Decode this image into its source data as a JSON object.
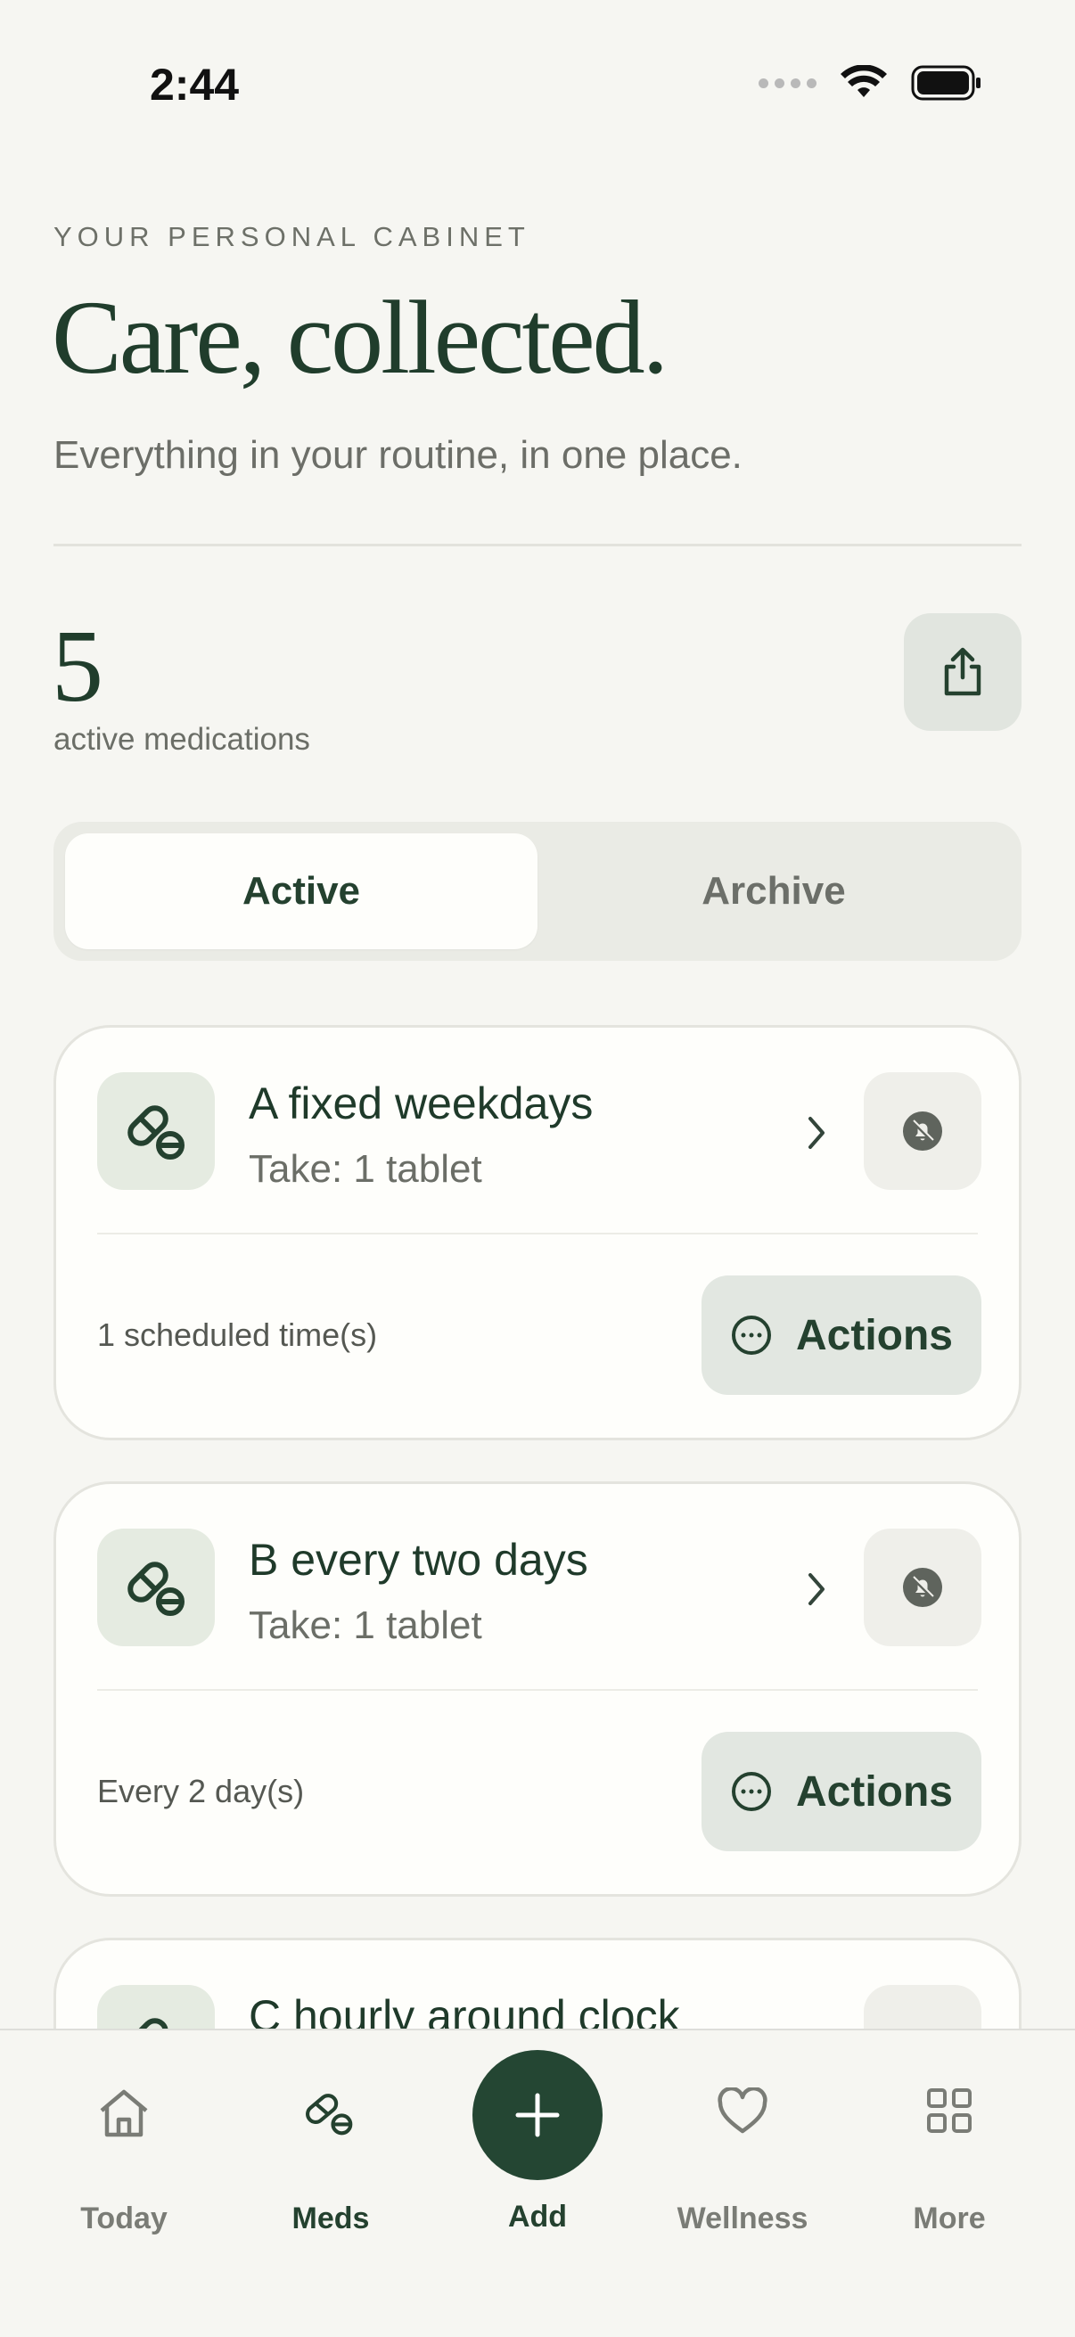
{
  "status_bar": {
    "time": "2:44"
  },
  "header": {
    "eyebrow": "YOUR PERSONAL CABINET",
    "title": "Care, collected.",
    "subtitle": "Everything in your routine, in one place."
  },
  "summary": {
    "count": "5",
    "label": "active medications"
  },
  "segments": {
    "active": "Active",
    "archive": "Archive",
    "selected": "Active"
  },
  "medications": [
    {
      "name": "A fixed weekdays",
      "dose": "Take: 1 tablet",
      "schedule": "1 scheduled time(s)",
      "action": "Actions"
    },
    {
      "name": "B every two days",
      "dose": "Take: 1 tablet",
      "schedule": "Every 2 day(s)",
      "action": "Actions"
    },
    {
      "name": "C hourly around clock"
    }
  ],
  "tabbar": {
    "today": "Today",
    "meds": "Meds",
    "add": "Add",
    "wellness": "Wellness",
    "more": "More",
    "selected": "Meds"
  },
  "colors": {
    "background": "#f6f6f2",
    "accent": "#244633",
    "card": "#fefefb"
  }
}
